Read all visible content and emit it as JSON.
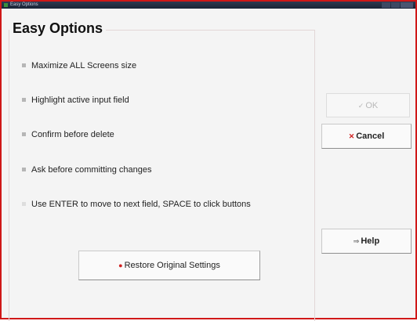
{
  "window": {
    "title": "Easy Options"
  },
  "dialog": {
    "title": "Easy Options"
  },
  "options": [
    {
      "label": "Maximize ALL Screens size",
      "checked": true
    },
    {
      "label": "Highlight active input field",
      "checked": true
    },
    {
      "label": "Confirm before delete",
      "checked": true
    },
    {
      "label": "Ask before committing changes",
      "checked": true
    },
    {
      "label": "Use ENTER to move to next field, SPACE to click buttons",
      "checked": false
    }
  ],
  "buttons": {
    "ok": {
      "label": "OK",
      "icon": "check-icon",
      "enabled": false
    },
    "cancel": {
      "label": "Cancel",
      "icon": "x-icon",
      "enabled": true
    },
    "help": {
      "label": "Help",
      "icon": "arrow-right-icon",
      "enabled": true
    },
    "restore": {
      "label": "Restore Original Settings",
      "icon": "restore-icon",
      "enabled": true
    }
  },
  "colors": {
    "border": "#d01818",
    "cancel_icon": "#d02020",
    "titlebar": "#1b2436"
  }
}
